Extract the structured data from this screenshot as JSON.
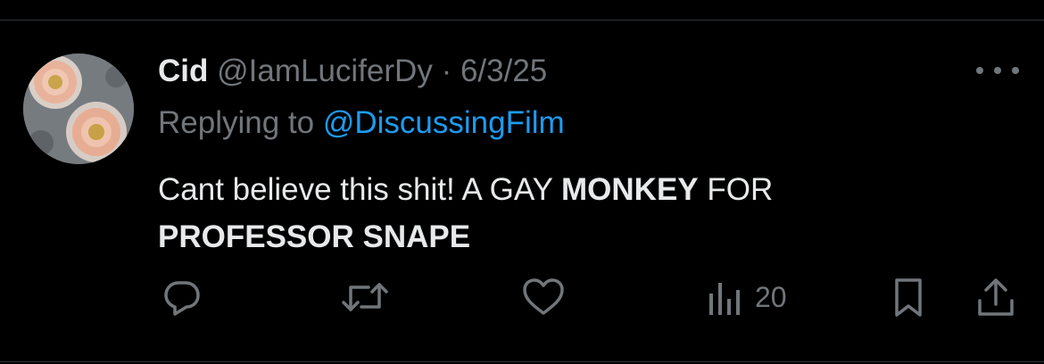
{
  "tweet": {
    "author": {
      "display_name": "Cid",
      "handle": "@IamLuciferDy",
      "avatar_icon": "avatar-photo"
    },
    "separator": "·",
    "date": "6/3/25",
    "reply_prefix": "Replying to",
    "reply_to": "@DiscussingFilm",
    "text_parts": [
      "Cant believe this shit! A GAY ",
      "MONKEY",
      " FOR",
      "PROFESSOR SNAPE"
    ],
    "actions": {
      "reply_icon": "reply-icon",
      "retweet_icon": "retweet-icon",
      "like_icon": "like-icon",
      "views_icon": "views-icon",
      "views_count": "20",
      "bookmark_icon": "bookmark-icon",
      "share_icon": "share-icon",
      "more_icon": "more-options-icon"
    }
  },
  "colors": {
    "background": "#000000",
    "primary_text": "#e7e9ea",
    "secondary_text": "#71767b",
    "link": "#1d9bf0",
    "divider": "#2f3336"
  }
}
